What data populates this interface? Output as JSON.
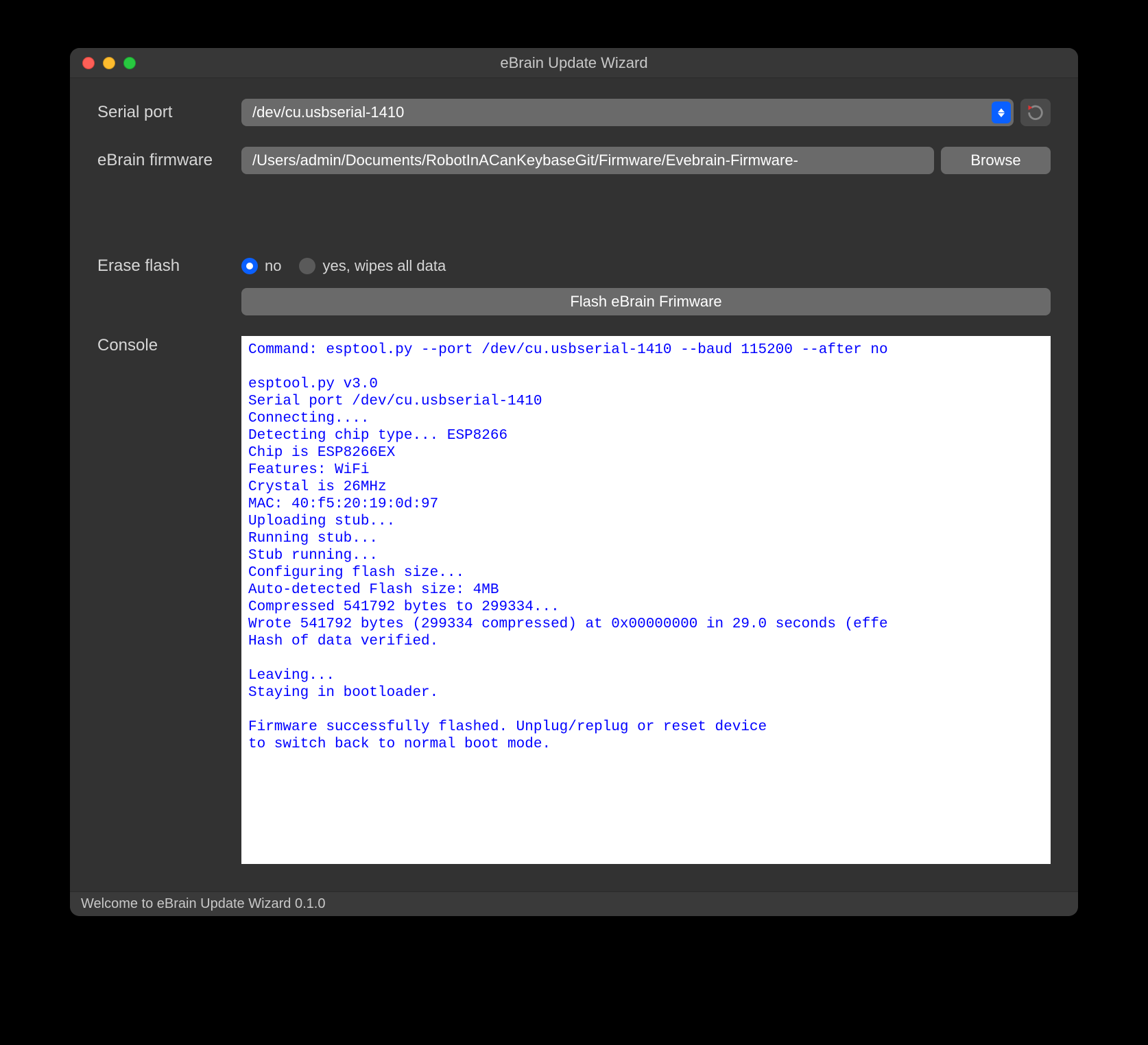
{
  "window": {
    "title": "eBrain Update Wizard"
  },
  "form": {
    "serial_port_label": "Serial port",
    "serial_port_value": "/dev/cu.usbserial-1410",
    "firmware_label": "eBrain firmware",
    "firmware_value": "/Users/admin/Documents/RobotInACanKeybaseGit/Firmware/Evebrain-Firmware-",
    "browse_label": "Browse",
    "erase_label": "Erase flash",
    "erase_no": "no",
    "erase_yes": "yes, wipes all data",
    "flash_button": "Flash eBrain Frimware",
    "console_label": "Console"
  },
  "console_text": "Command: esptool.py --port /dev/cu.usbserial-1410 --baud 115200 --after no\n\nesptool.py v3.0\nSerial port /dev/cu.usbserial-1410\nConnecting....\nDetecting chip type... ESP8266\nChip is ESP8266EX\nFeatures: WiFi\nCrystal is 26MHz\nMAC: 40:f5:20:19:0d:97\nUploading stub...\nRunning stub...\nStub running...\nConfiguring flash size...\nAuto-detected Flash size: 4MB\nCompressed 541792 bytes to 299334...\nWrote 541792 bytes (299334 compressed) at 0x00000000 in 29.0 seconds (effe\nHash of data verified.\n\nLeaving...\nStaying in bootloader.\n\nFirmware successfully flashed. Unplug/replug or reset device \nto switch back to normal boot mode.",
  "statusbar": {
    "text": "Welcome to eBrain Update Wizard 0.1.0"
  }
}
